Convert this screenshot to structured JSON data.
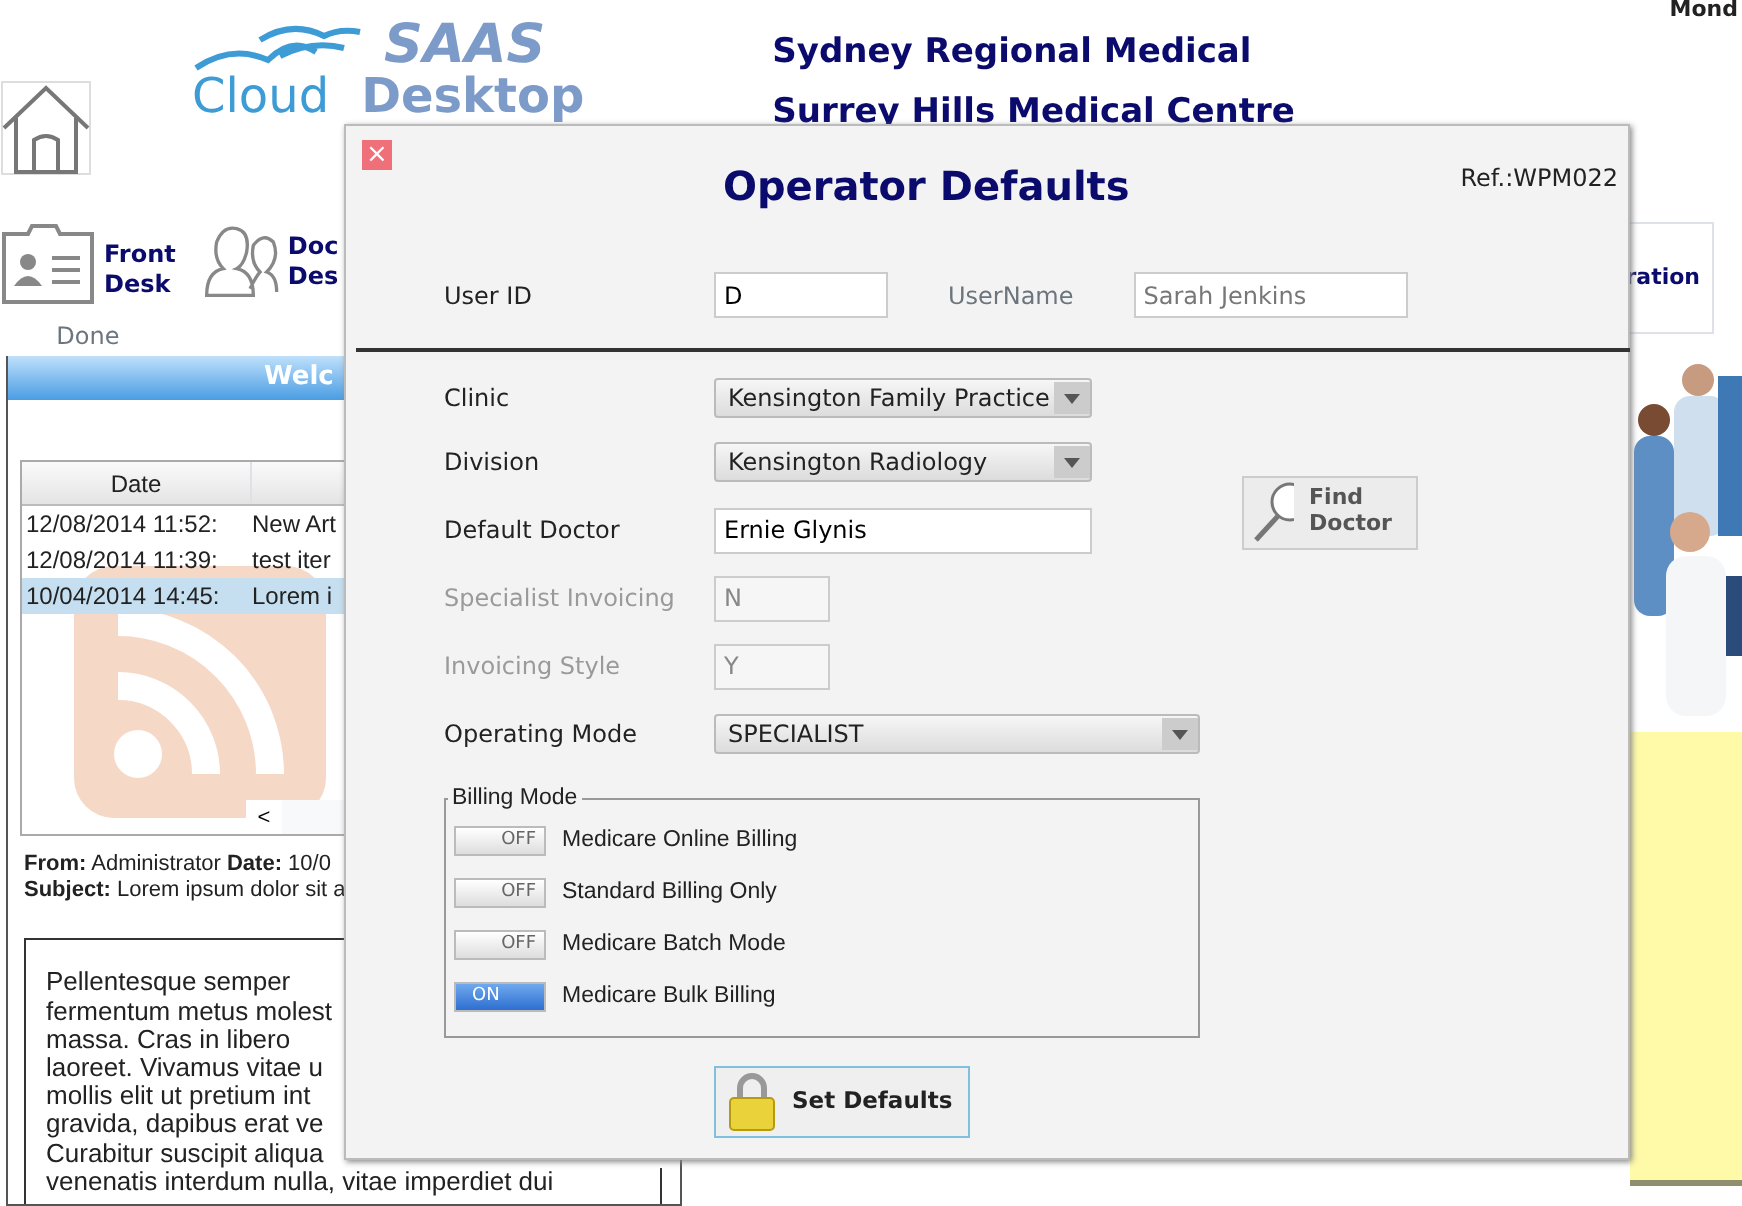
{
  "header": {
    "logo_top": "SAAS",
    "logo_left": "Cloud",
    "logo_right": "Desktop",
    "practice": "Sydney Regional Medical",
    "centre": "Surrey Hills Medical Centre",
    "date": "Mond"
  },
  "nav": [
    {
      "kind": "home"
    },
    {
      "kind": "card",
      "lines": [
        "Front",
        "Desk"
      ],
      "caption": "Done"
    },
    {
      "kind": "people",
      "lines": [
        "Doc",
        "Des"
      ]
    }
  ],
  "nav_right": {
    "label": "ration"
  },
  "news": {
    "title": "Welc",
    "columns": [
      "Date"
    ],
    "rows": [
      {
        "date": "12/08/2014 11:52:",
        "title": "New Art",
        "selected": false
      },
      {
        "date": "12/08/2014 11:39:",
        "title": "test iter",
        "selected": false
      },
      {
        "date": "10/04/2014 14:45:",
        "title": "Lorem i",
        "selected": true
      }
    ],
    "scroll_left": "<",
    "from": "**From:** Administrator **Date:** 10/0",
    "subject": "**Subject:** Lorem ipsum dolor sit a",
    "body_lines": [
      "Pellentesque semper",
      "fermentum metus molest",
      "massa. Cras in libero",
      "laoreet. Vivamus vitae u",
      "mollis elit ut pretium int",
      "gravida, dapibus erat ve",
      "Curabitur suscipit aliqua",
      "venenatis interdum nulla, vitae imperdiet dui"
    ]
  },
  "dialog": {
    "close": "×",
    "title": "Operator Defaults",
    "ref": "Ref.:WPM022",
    "user_id_label": "User ID",
    "user_id": "D",
    "username_label": "UserName",
    "username": "Sarah Jenkins",
    "fields": [
      {
        "kind": "select",
        "label": "Clinic",
        "value": "Kensington Family Practice",
        "disabled": false
      },
      {
        "kind": "select",
        "label": "Division",
        "value": "Kensington Radiology",
        "disabled": false
      },
      {
        "kind": "text",
        "label": "Default Doctor",
        "value": "Ernie Glynis",
        "disabled": false
      },
      {
        "kind": "short",
        "label": "Specialist Invoicing",
        "value": "N",
        "disabled": true
      },
      {
        "kind": "short",
        "label": "Invoicing Style",
        "value": "Y",
        "disabled": true
      },
      {
        "kind": "wide-select",
        "label": "Operating Mode",
        "value": "SPECIALIST",
        "disabled": false
      }
    ],
    "find_button": "Find Doctor",
    "billing_title": "Billing Mode",
    "billing": [
      {
        "label": "Medicare Online Billing",
        "state": "OFF",
        "on": false
      },
      {
        "label": "Standard Billing Only",
        "state": "OFF",
        "on": false
      },
      {
        "label": "Medicare Batch Mode",
        "state": "OFF",
        "on": false
      },
      {
        "label": "Medicare Bulk Billing",
        "state": "ON",
        "on": true
      }
    ],
    "set_button": "Set Defaults"
  }
}
